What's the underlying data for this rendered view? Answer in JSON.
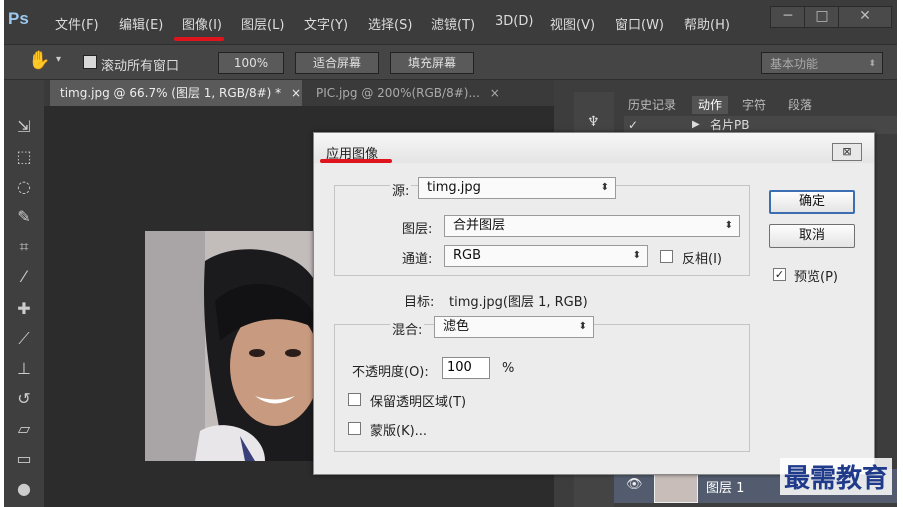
{
  "app": {
    "logo": "Ps",
    "menu": [
      "文件(F)",
      "编辑(E)",
      "图像(I)",
      "图层(L)",
      "文字(Y)",
      "选择(S)",
      "滤镜(T)",
      "3D(D)",
      "视图(V)",
      "窗口(W)",
      "帮助(H)"
    ],
    "window_controls": [
      "─",
      "□",
      "✕"
    ]
  },
  "options_bar": {
    "scroll_all_label": "滚动所有窗口",
    "zoom_100": "100%",
    "fit_screen": "适合屏幕",
    "fill_screen": "填充屏幕",
    "workspace": "基本功能"
  },
  "tabs": [
    {
      "label": "timg.jpg @ 66.7% (图层 1, RGB/8#) *",
      "close": "×"
    },
    {
      "label": "PIC.jpg @ 200%(RGB/8#)...",
      "close": "×"
    }
  ],
  "panels": {
    "tabs": [
      "历史记录",
      "动作",
      "字符",
      "段落"
    ],
    "action_item": "名片PB",
    "layer_name": "图层 1"
  },
  "dialog": {
    "title": "应用图像",
    "close": "⊠",
    "source_label": "源:",
    "source_value": "timg.jpg",
    "layer_label": "图层:",
    "layer_value": "合并图层",
    "channel_label": "通道:",
    "channel_value": "RGB",
    "invert_label": "反相(I)",
    "target_label": "目标:",
    "target_value": "timg.jpg(图层 1, RGB)",
    "blend_label": "混合:",
    "blend_value": "滤色",
    "opacity_label": "不透明度(O):",
    "opacity_value": "100",
    "opacity_unit": "%",
    "preserve_label": "保留透明区域(T)",
    "mask_label": "蒙版(K)...",
    "ok": "确定",
    "cancel": "取消",
    "preview_label": "预览(P)",
    "preview_checked": true
  },
  "watermark": "最需教育"
}
